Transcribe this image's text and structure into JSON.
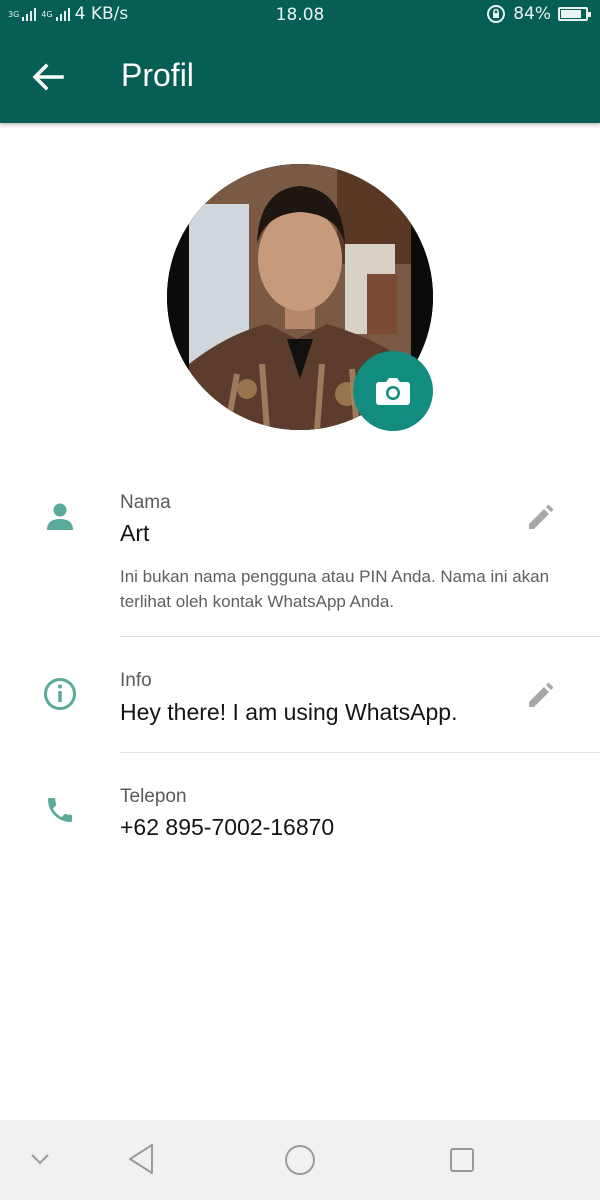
{
  "status_bar": {
    "network_left": "3G",
    "network_right": "4G",
    "speed": "4 KB/s",
    "time": "18.08",
    "battery": "84%",
    "battery_level": 0.84
  },
  "app_bar": {
    "title": "Profil",
    "back_icon": "arrow-back-icon"
  },
  "profile": {
    "photo_alt": "profile photo",
    "camera_icon": "camera-icon"
  },
  "name_section": {
    "label": "Nama",
    "value": "Art",
    "hint": "Ini bukan nama pengguna atau PIN Anda. Nama ini akan terlihat oleh kontak WhatsApp Anda.",
    "icon": "person-icon",
    "edit_icon": "pencil-icon"
  },
  "info_section": {
    "label": "Info",
    "value": "Hey there! I am using WhatsApp.",
    "icon": "info-icon",
    "edit_icon": "pencil-icon"
  },
  "phone_section": {
    "label": "Telepon",
    "value": "+62 895-7002-16870",
    "icon": "phone-icon"
  },
  "nav_bar": {
    "items": [
      "chevron-down-icon",
      "back-triangle-icon",
      "home-circle-icon",
      "recents-square-icon"
    ]
  },
  "colors": {
    "header": "#075e54",
    "accent": "#128c7e",
    "icon": "#5ba99a"
  }
}
